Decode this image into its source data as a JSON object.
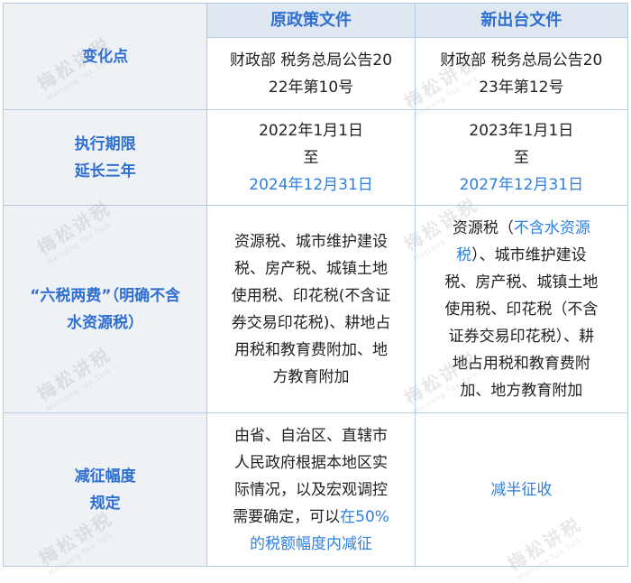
{
  "header": {
    "col_change": "变化点",
    "col_old": "原政策文件",
    "col_new": "新出台文件",
    "old_doc": [
      "财政部 税务总局公告20",
      "22年第10号"
    ],
    "new_doc": [
      "财政部 税务总局公告20",
      "23年第12号"
    ]
  },
  "rows": {
    "period": {
      "label": [
        "执行期限",
        "延长三年"
      ],
      "old": [
        "2022年1月1日",
        "至",
        "2024年12月31日"
      ],
      "new": [
        "2023年1月1日",
        "至",
        "2027年12月31日"
      ]
    },
    "taxes": {
      "label": [
        "“六税两费”（明确不含",
        "水资源税）"
      ],
      "old": [
        "资源税、城市维护建设",
        "税、房产税、城镇土地",
        "使用税、印花税(不含证",
        "券交易印花税)、耕地占",
        "用税和教育费附加、地",
        "方教育附加"
      ],
      "new_line1_a": "资源税（",
      "new_line1_b": "不含水资源",
      "new_line2_a": "税",
      "new_line2_b": "）、城市维护建设",
      "new_rest": [
        "税、房产税、城镇土地",
        "使用税、印花税（不含",
        "证券交易印花税）、耕",
        "地占用税和教育费附",
        "加、地方教育附加"
      ]
    },
    "range": {
      "label": [
        "减征幅度",
        "规定"
      ],
      "old": [
        "由省、自治区、直辖市",
        "人民政府根据本地区实",
        "际情况，以及宏观调控"
      ],
      "old_line4_a": "需要确定，可以",
      "old_line4_b": "在50%",
      "old_line5": "的税额幅度内减征",
      "new": "减半征收"
    }
  },
  "watermark": {
    "text": "梅松讲税",
    "sub": "Meisong Tax Talk"
  },
  "colors": {
    "accent": "#2f6fd0",
    "link": "#2f7fe0",
    "border": "#b9cbe0",
    "label_bg": "#eef2f7",
    "header_bg": "#dfe7f1"
  }
}
